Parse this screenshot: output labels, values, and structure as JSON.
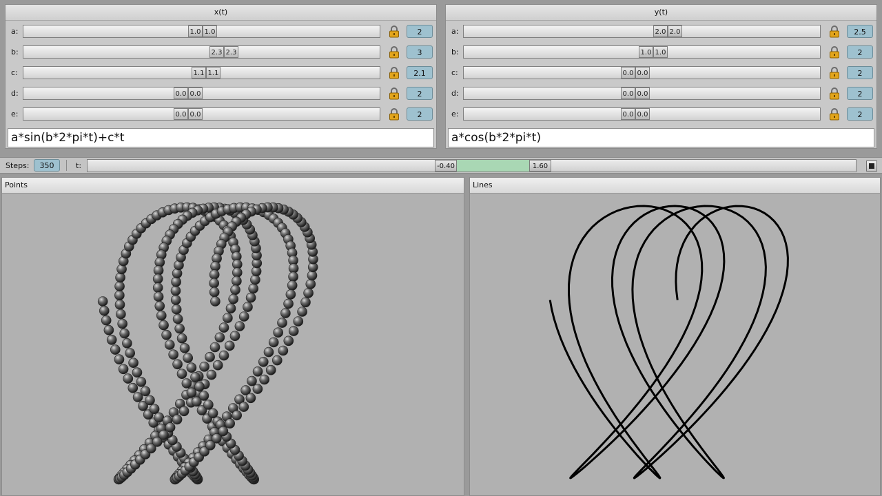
{
  "x_panel": {
    "title": "x(t)",
    "params": [
      {
        "label": "a:",
        "lo": "1.0",
        "hi": "1.0",
        "value": "2",
        "pos": 0.5
      },
      {
        "label": "b:",
        "lo": "2.3",
        "hi": "2.3",
        "value": "3",
        "pos": 0.56
      },
      {
        "label": "c:",
        "lo": "1.1",
        "hi": "1.1",
        "value": "2.1",
        "pos": 0.51
      },
      {
        "label": "d:",
        "lo": "0.0",
        "hi": "0.0",
        "value": "2",
        "pos": 0.46
      },
      {
        "label": "e:",
        "lo": "0.0",
        "hi": "0.0",
        "value": "2",
        "pos": 0.46
      }
    ],
    "expression": "a*sin(b*2*pi*t)+c*t"
  },
  "y_panel": {
    "title": "y(t)",
    "params": [
      {
        "label": "a:",
        "lo": "2.0",
        "hi": "2.0",
        "value": "2.5",
        "pos": 0.57
      },
      {
        "label": "b:",
        "lo": "1.0",
        "hi": "1.0",
        "value": "2",
        "pos": 0.53
      },
      {
        "label": "c:",
        "lo": "0.0",
        "hi": "0.0",
        "value": "2",
        "pos": 0.48
      },
      {
        "label": "d:",
        "lo": "0.0",
        "hi": "0.0",
        "value": "2",
        "pos": 0.48
      },
      {
        "label": "e:",
        "lo": "0.0",
        "hi": "0.0",
        "value": "2",
        "pos": 0.48
      }
    ],
    "expression": "a*cos(b*2*pi*t)"
  },
  "controls": {
    "steps_label": "Steps:",
    "steps_value": "350",
    "t_label": "t:",
    "t_min": "-0.40",
    "t_max": "1.60"
  },
  "views": {
    "points_title": "Points",
    "lines_title": "Lines"
  },
  "colors": {
    "value_box": "#9ec1cf",
    "range_fill": "#a9d7b4",
    "view_background": "#b1b1b1",
    "curve": "#000000"
  },
  "icons": {
    "lock": "lock-icon",
    "stop": "stop-icon"
  }
}
